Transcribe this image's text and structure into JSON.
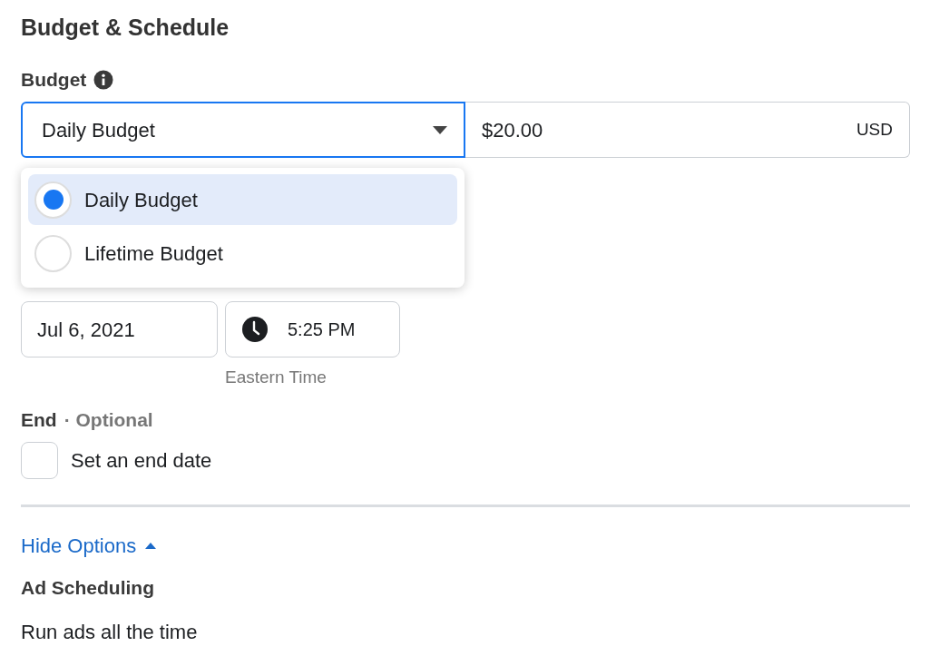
{
  "title": "Budget & Schedule",
  "budget": {
    "label": "Budget",
    "type_select": {
      "value": "Daily Budget",
      "expanded": true
    },
    "amount": {
      "value": "$20.00",
      "currency": "USD"
    },
    "options": [
      {
        "label": "Daily Budget",
        "selected": true
      },
      {
        "label": "Lifetime Budget",
        "selected": false
      }
    ]
  },
  "start": {
    "date": "Jul 6, 2021",
    "time": "5:25 PM",
    "timezone": "Eastern Time"
  },
  "end": {
    "label": "End",
    "optional": "· Optional",
    "checkbox": {
      "label": "Set an end date",
      "checked": false
    }
  },
  "options_toggle": {
    "label": "Hide Options",
    "expanded": true
  },
  "ad_scheduling": {
    "label": "Ad Scheduling",
    "value": "Run ads all the time"
  }
}
